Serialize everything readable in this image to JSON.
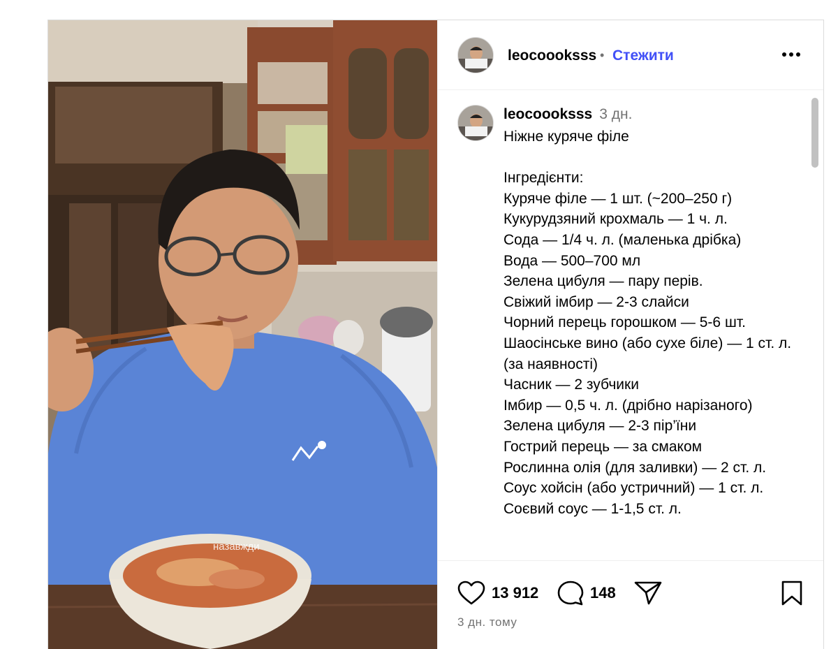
{
  "post": {
    "username": "leocoooksss",
    "separator": "•",
    "follow_label": "Стежити",
    "more_icon": "more-options-icon",
    "video_overlay_text": "назавжди"
  },
  "caption": {
    "username": "leocoooksss",
    "time": "3 дн.",
    "text": "Ніжне куряче філе\n\nІнгредієнти:\nКуряче філе — 1 шт. (~200–250 г)\nКукурудзяний крохмаль — 1 ч. л.\nСода — 1/4 ч. л. (маленька дрібка)\nВода — 500–700 мл\nЗелена цибуля — пару перів.\nСвіжий імбир — 2-3 слайси\nЧорний перець горошком — 5-6 шт.\nШаосінське вино (або сухе біле) — 1 ст. л. (за наявності)\nЧасник — 2 зубчики\nІмбир — 0,5 ч. л. (дрібно нарізаного)\nЗелена цибуля — 2-3 пір’їни\nГострий перець — за смаком\nРослинна олія (для заливки) — 2 ст. л.\nСоус хойсін (або устричний) — 1 ст. л.\nСоєвий соус — 1-1,5 ст. л."
  },
  "actions": {
    "likes": "13 912",
    "comments": "148",
    "posted_ago": "3 дн. тому"
  },
  "colors": {
    "accent": "#4150f7",
    "muted": "#737373",
    "border": "#dbdbdb",
    "tshirt": "#5a84d6"
  }
}
